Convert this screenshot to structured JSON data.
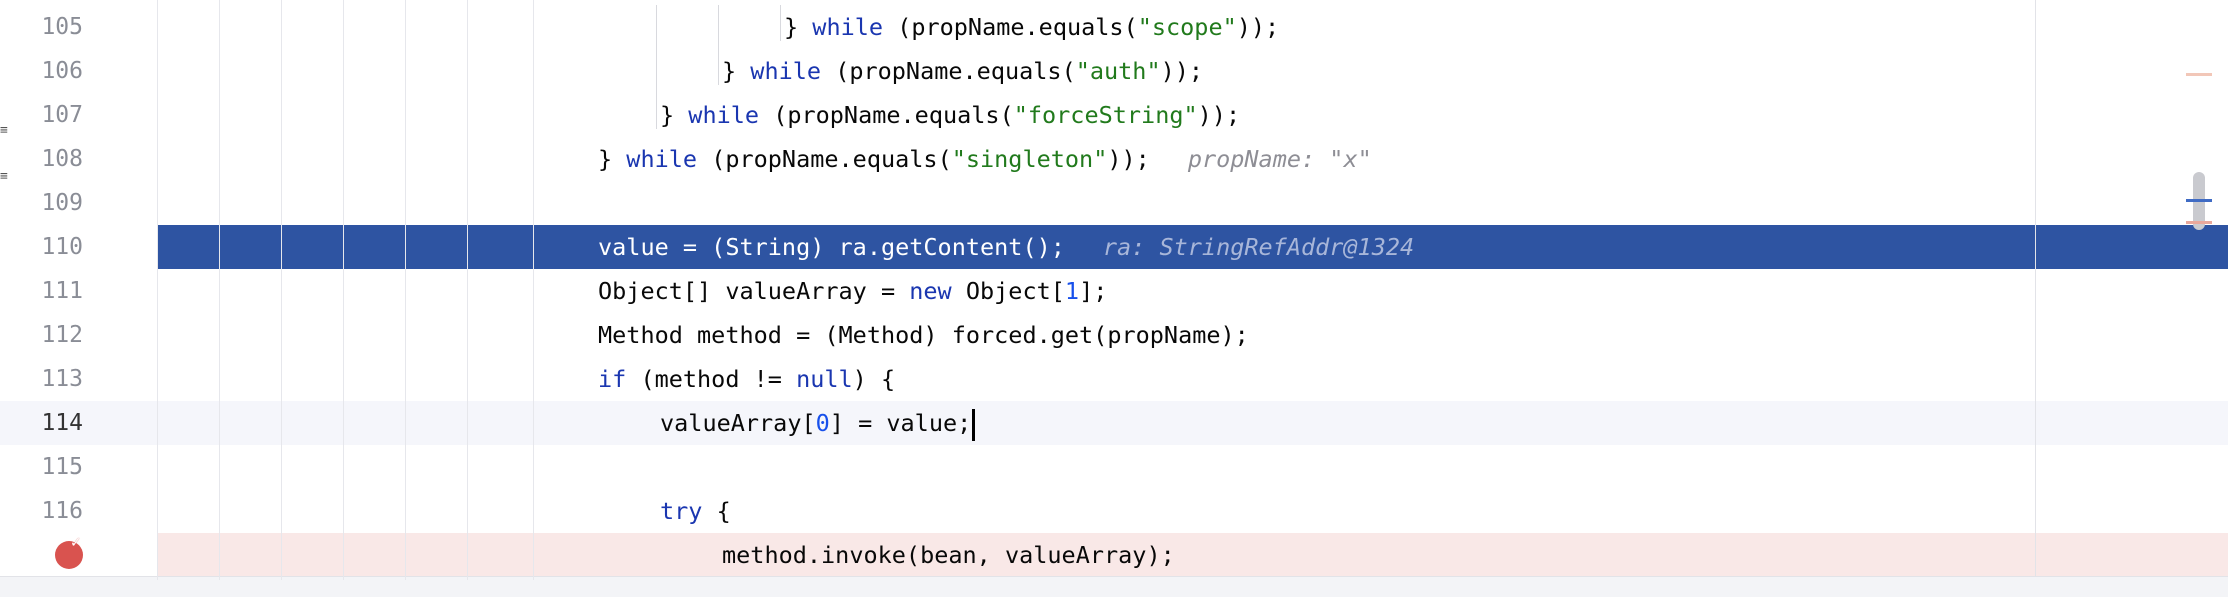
{
  "editor": {
    "lines": [
      {
        "no": "105",
        "indent": 784,
        "state": "normal",
        "tokens": [
          [
            "p",
            "} "
          ],
          [
            "kw",
            "while"
          ],
          [
            "p",
            " (propName.equals("
          ],
          [
            "str",
            "\"scope\""
          ],
          [
            "p",
            "));"
          ]
        ],
        "hint": ""
      },
      {
        "no": "106",
        "indent": 722,
        "state": "normal",
        "tokens": [
          [
            "p",
            "} "
          ],
          [
            "kw",
            "while"
          ],
          [
            "p",
            " (propName.equals("
          ],
          [
            "str",
            "\"auth\""
          ],
          [
            "p",
            "));"
          ]
        ],
        "hint": ""
      },
      {
        "no": "107",
        "indent": 660,
        "state": "normal",
        "tokens": [
          [
            "p",
            "} "
          ],
          [
            "kw",
            "while"
          ],
          [
            "p",
            " (propName.equals("
          ],
          [
            "str",
            "\"forceString\""
          ],
          [
            "p",
            "));"
          ]
        ],
        "hint": ""
      },
      {
        "no": "108",
        "indent": 598,
        "state": "normal",
        "tokens": [
          [
            "p",
            "} "
          ],
          [
            "kw",
            "while"
          ],
          [
            "p",
            " (propName.equals("
          ],
          [
            "str",
            "\"singleton\""
          ],
          [
            "p",
            "));"
          ]
        ],
        "hint": "propName: \"x\""
      },
      {
        "no": "109",
        "indent": 598,
        "state": "normal",
        "tokens": [],
        "hint": ""
      },
      {
        "no": "110",
        "indent": 598,
        "state": "exec",
        "tokens": [
          [
            "p",
            "value = (String) ra.getContent();"
          ]
        ],
        "hint": "ra: StringRefAddr@1324"
      },
      {
        "no": "111",
        "indent": 598,
        "state": "normal",
        "tokens": [
          [
            "p",
            "Object[] valueArray = "
          ],
          [
            "kw",
            "new"
          ],
          [
            "p",
            " Object["
          ],
          [
            "num",
            "1"
          ],
          [
            "p",
            "];"
          ]
        ],
        "hint": ""
      },
      {
        "no": "112",
        "indent": 598,
        "state": "normal",
        "tokens": [
          [
            "p",
            "Method method = (Method) forced.get(propName);"
          ]
        ],
        "hint": ""
      },
      {
        "no": "113",
        "indent": 598,
        "state": "normal",
        "tokens": [
          [
            "kw",
            "if"
          ],
          [
            "p",
            " (method != "
          ],
          [
            "kw",
            "null"
          ],
          [
            "p",
            ") {"
          ]
        ],
        "hint": ""
      },
      {
        "no": "114",
        "indent": 660,
        "state": "current",
        "tokens": [
          [
            "p",
            "valueArray["
          ],
          [
            "num",
            "0"
          ],
          [
            "p",
            "] = value;"
          ]
        ],
        "hint": "",
        "caret": true
      },
      {
        "no": "115",
        "indent": 660,
        "state": "normal",
        "tokens": [],
        "hint": ""
      },
      {
        "no": "116",
        "indent": 660,
        "state": "normal",
        "tokens": [
          [
            "kw",
            "try"
          ],
          [
            "p",
            " {"
          ]
        ],
        "hint": ""
      },
      {
        "no": "",
        "indent": 722,
        "state": "bp",
        "tokens": [
          [
            "p",
            "method.invoke(bean, valueArray);"
          ]
        ],
        "hint": "",
        "breakpoint": true
      }
    ],
    "breakpoint_icon": "breakpoint-verified-icon",
    "colors": {
      "exec_bg": "#2e54a2",
      "bp_bg": "#f9e8e7",
      "keyword": "#1a36b0",
      "string": "#217a1c",
      "number": "#1750eb",
      "hint": "#8e8e95"
    }
  }
}
